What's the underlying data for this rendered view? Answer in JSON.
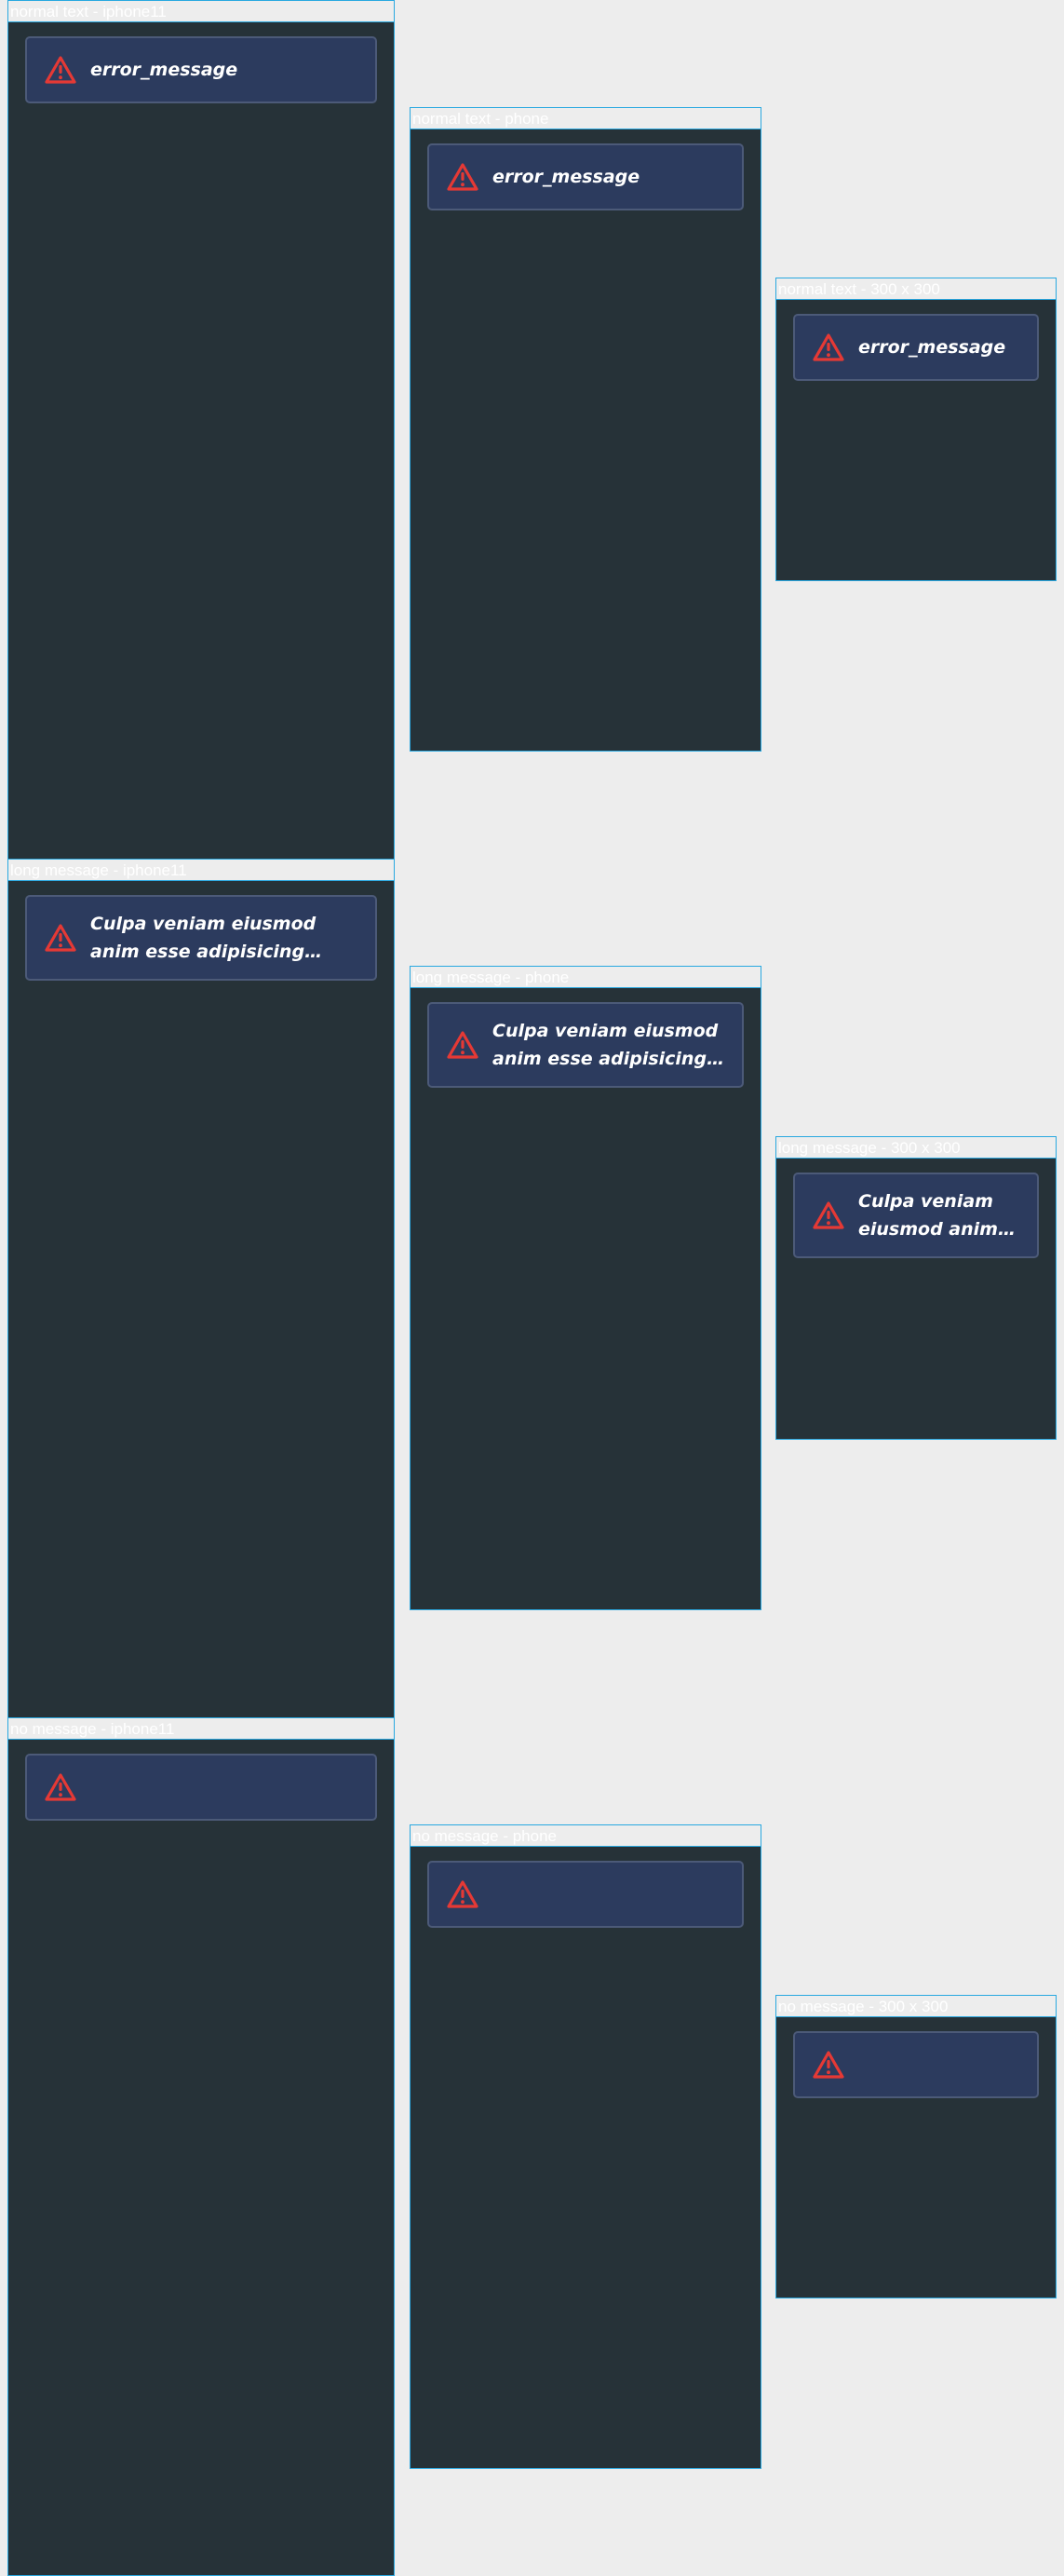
{
  "frames": {
    "normal_iphone11": {
      "label": "normal text - iphone11",
      "message": "error_message"
    },
    "normal_phone": {
      "label": "normal text - phone",
      "message": "error_message"
    },
    "normal_300": {
      "label": "normal text - 300 x 300",
      "message": "error_message"
    },
    "long_iphone11": {
      "label": "long message - iphone11",
      "message": "Culpa veniam eiusmod anim esse adipisicing minim esse ..."
    },
    "long_phone": {
      "label": "long message - phone",
      "message": "Culpa veniam eiusmod anim esse adipisicing ..."
    },
    "long_300": {
      "label": "long message - 300 x 300",
      "message": "Culpa veniam eiusmod anim ess..."
    },
    "none_iphone11": {
      "label": "no message - iphone11",
      "message": ""
    },
    "none_phone": {
      "label": "no message - phone",
      "message": ""
    },
    "none_300": {
      "label": "no message - 300 x 300",
      "message": ""
    }
  },
  "colors": {
    "frame_background": "#263238",
    "frame_border": "#29a8e0",
    "error_box_background": "#2c3b5e",
    "warning_icon": "#e53935"
  },
  "icons": {
    "warning": "warning-triangle-icon"
  }
}
